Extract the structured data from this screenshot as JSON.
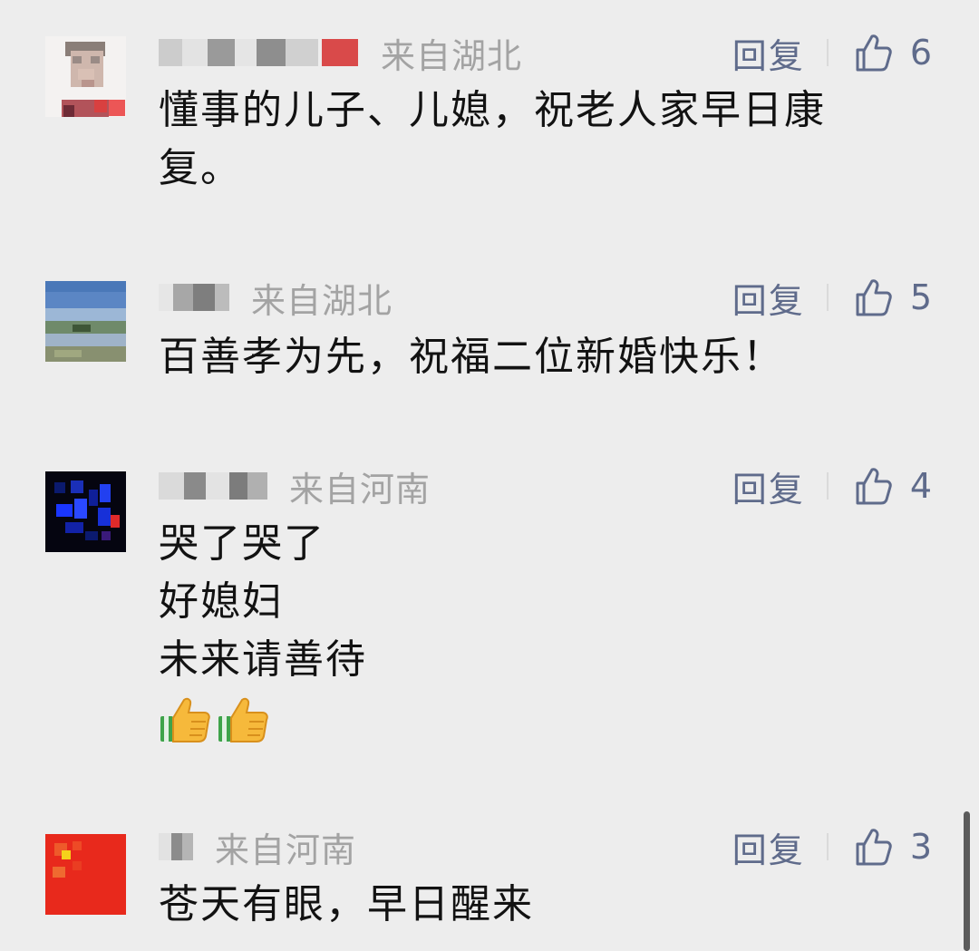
{
  "reply_label": "回复",
  "comments": [
    {
      "location": "来自湖北",
      "likes": "6",
      "lines": [
        "懂事的儿子、儿媳，祝老人家早日康",
        "复。"
      ]
    },
    {
      "location": "来自湖北",
      "likes": "5",
      "lines": [
        "百善孝为先，祝福二位新婚快乐！"
      ]
    },
    {
      "location": "来自河南",
      "likes": "4",
      "lines": [
        "哭了哭了",
        "好媳妇",
        "未来请善待"
      ],
      "emojis": [
        "thumbs-up",
        "thumbs-up"
      ]
    },
    {
      "location": "来自河南",
      "likes": "3",
      "lines": [
        "苍天有眼，早日醒来"
      ]
    }
  ],
  "colors": {
    "background": "#ededed",
    "meta_text": "#a3a3a3",
    "action_text": "#5f6b8b",
    "content_text": "#121212"
  }
}
